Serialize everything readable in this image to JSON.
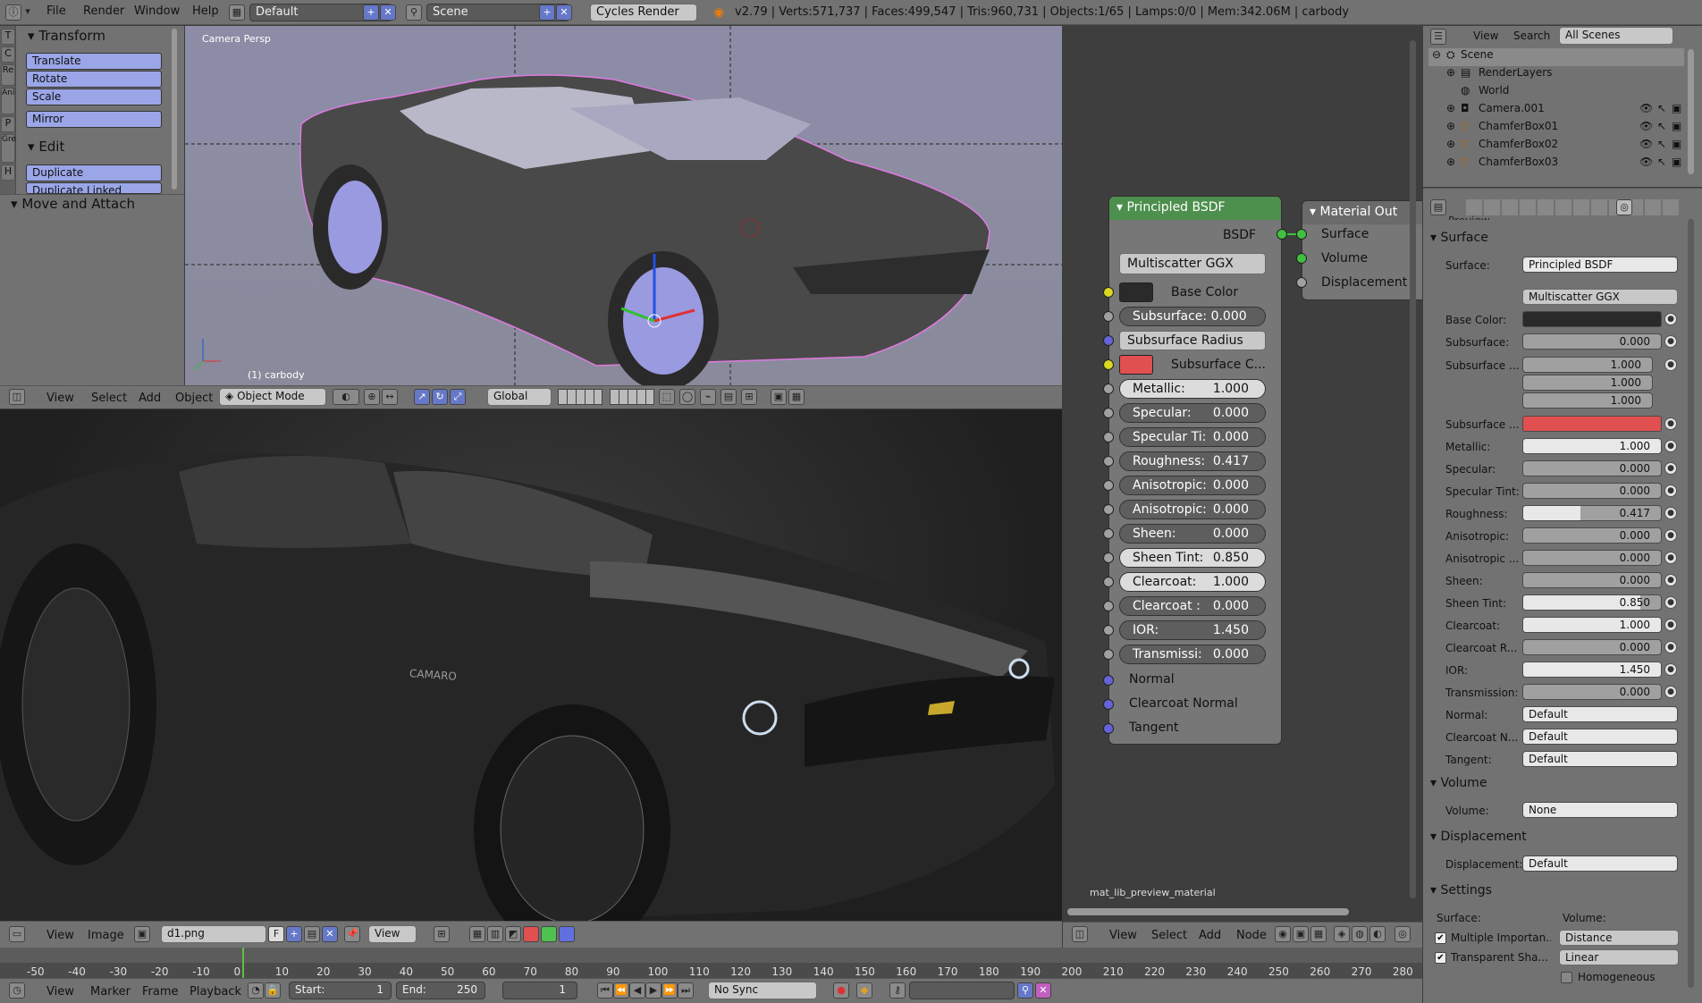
{
  "topbar": {
    "menus": [
      "File",
      "Render",
      "Window",
      "Help"
    ],
    "layout": "Default",
    "scene": "Scene",
    "engine": "Cycles Render",
    "stats": "v2.79 | Verts:571,737 | Faces:499,547 | Tris:960,731 | Objects:1/65 | Lamps:0/0 | Mem:342.06M | carbody"
  },
  "toolshelf": {
    "tabs": [
      "T",
      "C",
      "Re",
      "Ani",
      "P",
      "Gre",
      "H"
    ],
    "transform_title": "Transform",
    "transform_buttons": [
      "Translate",
      "Rotate",
      "Scale",
      "Mirror"
    ],
    "edit_title": "Edit",
    "edit_buttons": [
      "Duplicate",
      "Duplicate Linked"
    ],
    "operator_title": "Move and Attach"
  },
  "viewport": {
    "label": "Camera Persp",
    "object_label": "(1) carbody",
    "menus": [
      "View",
      "Select",
      "Add",
      "Object"
    ],
    "mode": "Object Mode",
    "orientation": "Global"
  },
  "render": {
    "badge": "CAMARO"
  },
  "image_editor": {
    "menus": [
      "View",
      "Image"
    ],
    "image_name": "d1.png",
    "fake_user": "F",
    "view_menu": "View"
  },
  "node_editor": {
    "node_title": "Principled BSDF",
    "output_label": "BSDF",
    "distribution": "Multiscatter GGX",
    "base_color_label": "Base Color",
    "subsurface": "Subsurface:",
    "subsurface_val": "0.000",
    "subsurface_radius": "Subsurface Radius",
    "subsurface_color": "Subsurface C...",
    "fields": [
      {
        "label": "Metallic:",
        "value": "1.000",
        "white": true
      },
      {
        "label": "Specular:",
        "value": "0.000",
        "white": false
      },
      {
        "label": "Specular Ti:",
        "value": "0.000",
        "white": false
      },
      {
        "label": "Roughness:",
        "value": "0.417",
        "white": false
      },
      {
        "label": "Anisotropic:",
        "value": "0.000",
        "white": false
      },
      {
        "label": "Anisotropic:",
        "value": "0.000",
        "white": false
      },
      {
        "label": "Sheen:",
        "value": "0.000",
        "white": false
      },
      {
        "label": "Sheen Tint:",
        "value": "0.850",
        "white": true
      },
      {
        "label": "Clearcoat:",
        "value": "1.000",
        "white": true
      },
      {
        "label": "Clearcoat :",
        "value": "0.000",
        "white": false
      },
      {
        "label": "IOR:",
        "value": "1.450",
        "white": false
      },
      {
        "label": "Transmissi:",
        "value": "0.000",
        "white": false
      }
    ],
    "inputs": [
      "Normal",
      "Clearcoat Normal",
      "Tangent"
    ],
    "out_node_title": "Material Out",
    "out_inputs": [
      "Surface",
      "Volume",
      "Displacement"
    ],
    "material_name": "mat_lib_preview_material",
    "menus": [
      "View",
      "Select",
      "Add",
      "Node"
    ]
  },
  "outliner": {
    "menus": [
      "View",
      "Search"
    ],
    "filter": "All Scenes",
    "rows": [
      "Scene",
      "RenderLayers",
      "World",
      "Camera.001",
      "ChamferBox01",
      "ChamferBox02",
      "ChamferBox03"
    ]
  },
  "properties": {
    "preview_label": "Preview",
    "surface_section": "Surface",
    "surface_label": "Surface:",
    "surface_value": "Principled BSDF",
    "distribution": "Multiscatter GGX",
    "base_color_label": "Base Color:",
    "subsurface_label": "Subsurface:",
    "subsurface_value": "0.000",
    "subsurface_radius_label": "Subsurface ...",
    "subsurface_radius": [
      "1.000",
      "1.000",
      "1.000"
    ],
    "subsurface_color_label": "Subsurface ...",
    "rows": [
      {
        "label": "Metallic:",
        "value": "1.000",
        "fill": 1.0
      },
      {
        "label": "Specular:",
        "value": "0.000",
        "fill": 0.0
      },
      {
        "label": "Specular Tint:",
        "value": "0.000",
        "fill": 0.0
      },
      {
        "label": "Roughness:",
        "value": "0.417",
        "fill": 0.417
      },
      {
        "label": "Anisotropic:",
        "value": "0.000",
        "fill": 0.0
      },
      {
        "label": "Anisotropic ...",
        "value": "0.000",
        "fill": 0.0
      },
      {
        "label": "Sheen:",
        "value": "0.000",
        "fill": 0.0
      },
      {
        "label": "Sheen Tint:",
        "value": "0.850",
        "fill": 0.85
      },
      {
        "label": "Clearcoat:",
        "value": "1.000",
        "fill": 1.0
      },
      {
        "label": "Clearcoat R...",
        "value": "0.000",
        "fill": 0.0
      },
      {
        "label": "IOR:",
        "value": "1.450",
        "fill": 1.0
      },
      {
        "label": "Transmission:",
        "value": "0.000",
        "fill": 0.0
      }
    ],
    "normal_label": "Normal:",
    "normal_value": "Default",
    "clearcoat_normal_label": "Clearcoat N...",
    "clearcoat_normal_value": "Default",
    "tangent_label": "Tangent:",
    "tangent_value": "Default",
    "volume_section": "Volume",
    "volume_label": "Volume:",
    "volume_value": "None",
    "displacement_section": "Displacement",
    "displacement_label": "Displacement:",
    "displacement_value": "Default",
    "settings_section": "Settings",
    "settings_surface": "Surface:",
    "settings_volume": "Volume:",
    "multiple_importance": "Multiple Importan...",
    "transparent_shadows": "Transparent Sha...",
    "homogeneous": "Homogeneous",
    "volume_sampling": "Distance",
    "volume_interpolation": "Linear"
  },
  "timeline": {
    "ticks": [
      "-50",
      "-40",
      "-30",
      "-20",
      "-10",
      "0",
      "10",
      "20",
      "30",
      "40",
      "50",
      "60",
      "70",
      "80",
      "90",
      "100",
      "110",
      "120",
      "130",
      "140",
      "150",
      "160",
      "170",
      "180",
      "190",
      "200",
      "210",
      "220",
      "230",
      "240",
      "250",
      "260",
      "270",
      "280"
    ],
    "menus": [
      "View",
      "Marker",
      "Frame",
      "Playback"
    ],
    "start_label": "Start:",
    "start_value": "1",
    "end_label": "End:",
    "end_value": "250",
    "current_frame": "1",
    "sync": "No Sync"
  },
  "colors": {
    "accent_blue": "#9aa6e8",
    "node_header": "#4d8f4d",
    "subsurface_color": "#e05050",
    "base_color": "#2a2a2a",
    "socket_yellow": "#d8d820",
    "socket_grey": "#a0a0a0",
    "socket_blue": "#6464d8",
    "socket_green": "#40c040"
  }
}
